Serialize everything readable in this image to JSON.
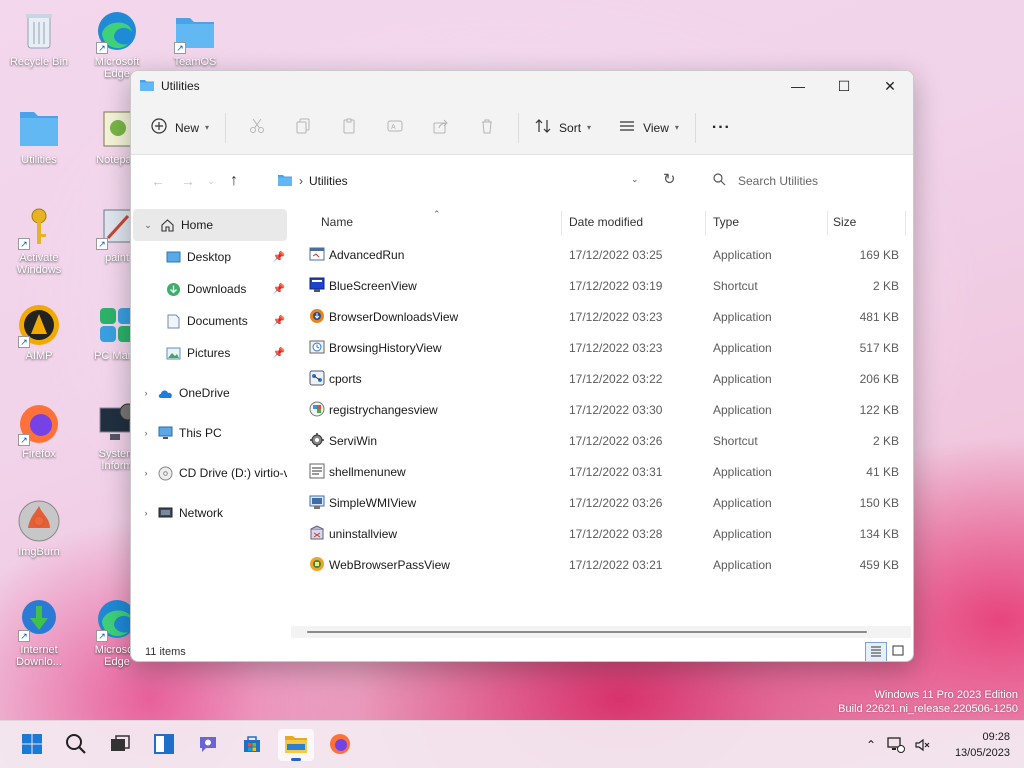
{
  "desktop": {
    "icons": [
      {
        "label": "Recycle Bin"
      },
      {
        "label": "Microsoft Edge"
      },
      {
        "label": "TeamOS"
      },
      {
        "label": "Utilities"
      },
      {
        "label": "Notepad"
      },
      {
        "label": "Activate Windows"
      },
      {
        "label": "paint"
      },
      {
        "label": "AIMP"
      },
      {
        "label": "PC Mana"
      },
      {
        "label": "Firefox"
      },
      {
        "label": "System Inform"
      },
      {
        "label": "ImgBurn"
      },
      {
        "label": "Internet Downlo..."
      },
      {
        "label": "Microsoft Edge"
      }
    ],
    "watermark_line1": "Windows 11 Pro 2023 Edition",
    "watermark_line2": "Build 22621.ni_release.220506-1250"
  },
  "window": {
    "title": "Utilities",
    "controls": {
      "minimize": "—",
      "maximize": "☐",
      "close": "✕"
    }
  },
  "toolbar": {
    "new_label": "New",
    "sort_label": "Sort",
    "view_label": "View",
    "more_label": "···"
  },
  "address": {
    "path_item": "Utilities",
    "search_placeholder": "Search Utilities"
  },
  "nav": {
    "home": "Home",
    "quick": [
      {
        "label": "Desktop"
      },
      {
        "label": "Downloads"
      },
      {
        "label": "Documents"
      },
      {
        "label": "Pictures"
      }
    ],
    "onedrive": "OneDrive",
    "thispc": "This PC",
    "cddrive": "CD Drive (D:) virtio-v",
    "network": "Network"
  },
  "columns": {
    "name": "Name",
    "date": "Date modified",
    "type": "Type",
    "size": "Size"
  },
  "files": [
    {
      "name": "AdvancedRun",
      "date": "17/12/2022 03:25",
      "type": "Application",
      "size": "169 KB",
      "icon": "app-window-icon"
    },
    {
      "name": "BlueScreenView",
      "date": "17/12/2022 03:19",
      "type": "Shortcut",
      "size": "2 KB",
      "icon": "bluescreen-icon"
    },
    {
      "name": "BrowserDownloadsView",
      "date": "17/12/2022 03:23",
      "type": "Application",
      "size": "481 KB",
      "icon": "browser-downloads-icon"
    },
    {
      "name": "BrowsingHistoryView",
      "date": "17/12/2022 03:23",
      "type": "Application",
      "size": "517 KB",
      "icon": "history-icon"
    },
    {
      "name": "cports",
      "date": "17/12/2022 03:22",
      "type": "Application",
      "size": "206 KB",
      "icon": "ports-icon"
    },
    {
      "name": "registrychangesview",
      "date": "17/12/2022 03:30",
      "type": "Application",
      "size": "122 KB",
      "icon": "registry-icon"
    },
    {
      "name": "ServiWin",
      "date": "17/12/2022 03:26",
      "type": "Shortcut",
      "size": "2 KB",
      "icon": "services-icon"
    },
    {
      "name": "shellmenunew",
      "date": "17/12/2022 03:31",
      "type": "Application",
      "size": "41 KB",
      "icon": "shell-menu-icon"
    },
    {
      "name": "SimpleWMIView",
      "date": "17/12/2022 03:26",
      "type": "Application",
      "size": "150 KB",
      "icon": "wmi-icon"
    },
    {
      "name": "uninstallview",
      "date": "17/12/2022 03:28",
      "type": "Application",
      "size": "134 KB",
      "icon": "uninstall-icon"
    },
    {
      "name": "WebBrowserPassView",
      "date": "17/12/2022 03:21",
      "type": "Application",
      "size": "459 KB",
      "icon": "password-icon"
    }
  ],
  "status": {
    "items_count": "11 items"
  },
  "taskbar": {
    "time": "09:28",
    "date": "13/05/2023"
  },
  "colors": {
    "accent": "#2563c9",
    "folder": "#5eb0ef"
  }
}
